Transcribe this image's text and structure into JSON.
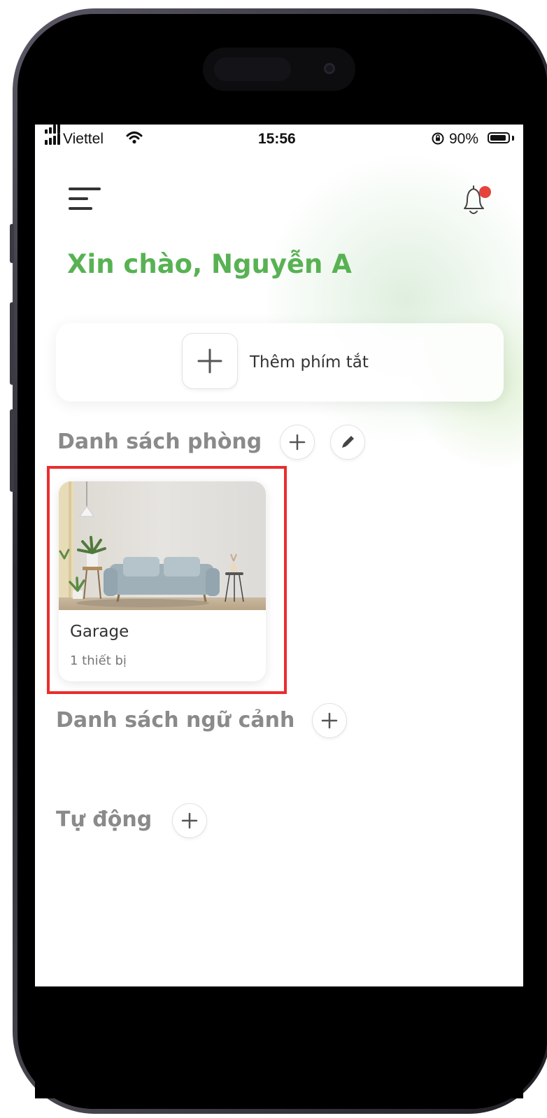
{
  "status_bar": {
    "carrier": "Viettel",
    "time": "15:56",
    "battery_percent": "90%",
    "battery_level": 0.9
  },
  "header": {
    "greeting": "Xin chào, Nguyễn A",
    "notification_badge": true
  },
  "shortcut": {
    "add_label": "Thêm phím tắt"
  },
  "rooms": {
    "title": "Danh sách phòng",
    "items": [
      {
        "name": "Garage",
        "device_count": "1 thiết bị",
        "highlighted": true
      }
    ]
  },
  "scenes": {
    "title": "Danh sách ngữ cảnh"
  },
  "automation": {
    "title": "Tự động"
  },
  "colors": {
    "accent_green": "#58b253",
    "highlight_red": "#ea2d2d",
    "badge_red": "#e5433c"
  },
  "icons": [
    "menu-icon",
    "bell-icon",
    "plus-icon",
    "pencil-icon",
    "wifi-icon",
    "signal-icon",
    "battery-icon",
    "orientation-lock-icon"
  ]
}
